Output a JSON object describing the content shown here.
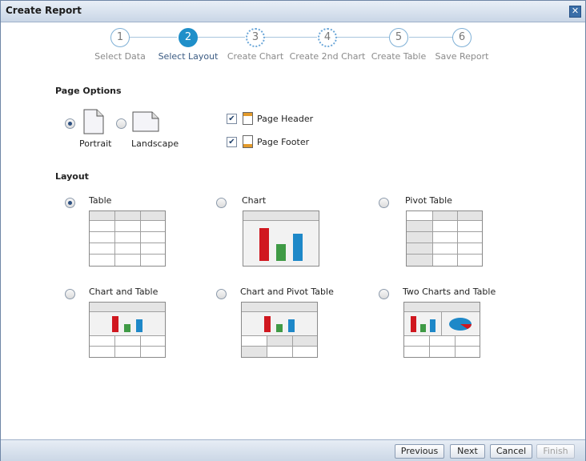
{
  "window": {
    "title": "Create Report"
  },
  "wizard": {
    "steps": [
      {
        "number": "1",
        "label": "Select Data"
      },
      {
        "number": "2",
        "label": "Select Layout"
      },
      {
        "number": "3",
        "label": "Create Chart"
      },
      {
        "number": "4",
        "label": "Create 2nd Chart"
      },
      {
        "number": "5",
        "label": "Create Table"
      },
      {
        "number": "6",
        "label": "Save Report"
      }
    ],
    "current_step": 2
  },
  "page_options": {
    "heading": "Page Options",
    "orientation": {
      "portrait_label": "Portrait",
      "landscape_label": "Landscape",
      "selected": "Portrait"
    },
    "page_header": {
      "label": "Page Header",
      "checked": true
    },
    "page_footer": {
      "label": "Page Footer",
      "checked": true
    }
  },
  "layout": {
    "heading": "Layout",
    "options": [
      {
        "label": "Table",
        "selected": true
      },
      {
        "label": "Chart",
        "selected": false
      },
      {
        "label": "Pivot Table",
        "selected": false
      },
      {
        "label": "Chart and Table",
        "selected": false
      },
      {
        "label": "Chart and Pivot Table",
        "selected": false
      },
      {
        "label": "Two Charts and Table",
        "selected": false
      }
    ]
  },
  "footer": {
    "previous": "Previous",
    "next": "Next",
    "cancel": "Cancel",
    "finish": "Finish"
  },
  "colors": {
    "accent": "#1f8fc9",
    "bar_red": "#d0171f",
    "bar_green": "#3f9a45",
    "bar_blue": "#1e88c8"
  }
}
